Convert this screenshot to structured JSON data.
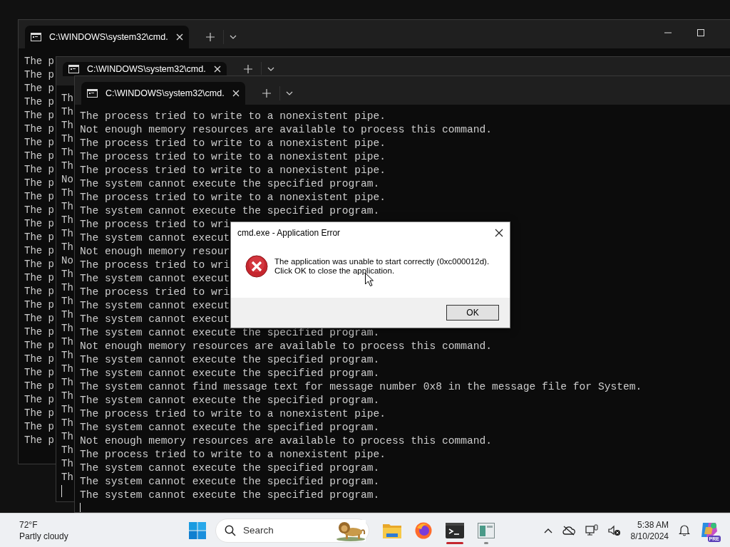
{
  "windows": [
    {
      "tab_title": "C:\\WINDOWS\\system32\\cmd.",
      "lines": [
        "The p",
        "The p",
        "The p",
        "The p",
        "The p",
        "The p",
        "The p",
        "The p",
        "The p",
        "The p",
        "The p",
        "The p",
        "The p",
        "The p",
        "The p",
        "The p",
        "The p",
        "The p",
        "The p",
        "The p",
        "The p",
        "The p",
        "The p",
        "The p",
        "The p",
        "The p",
        "The p",
        "The p",
        "The p"
      ]
    },
    {
      "tab_title": "C:\\WINDOWS\\system32\\cmd.",
      "lines": [
        "Th",
        "Th",
        "Th",
        "Th",
        "Th",
        "Th",
        "No",
        "Th",
        "Th",
        "Th",
        "Th",
        "Th",
        "No",
        "Th",
        "Th",
        "Th",
        "Th",
        "Th",
        "Th",
        "Th",
        "Th",
        "Th",
        "Th",
        "Th",
        "Th",
        "Th",
        "Th",
        "Th",
        "Th"
      ]
    },
    {
      "tab_title": "C:\\WINDOWS\\system32\\cmd.",
      "lines": [
        "The process tried to write to a nonexistent pipe.",
        "Not enough memory resources are available to process this command.",
        "The process tried to write to a nonexistent pipe.",
        "The process tried to write to a nonexistent pipe.",
        "The process tried to write to a nonexistent pipe.",
        "The system cannot execute the specified program.",
        "The process tried to write to a nonexistent pipe.",
        "The system cannot execute the specified program.",
        "The process tried to wri",
        "The system cannot execut",
        "Not enough memory resour",
        "The process tried to wri",
        "The system cannot execut",
        "The process tried to wri",
        "The system cannot execut",
        "The system cannot execut",
        "The system cannot execute the specified program.",
        "Not enough memory resources are available to process this command.",
        "The system cannot execute the specified program.",
        "The system cannot execute the specified program.",
        "The system cannot find message text for message number 0x8 in the message file for System.",
        "The system cannot execute the specified program.",
        "The process tried to write to a nonexistent pipe.",
        "The system cannot execute the specified program.",
        "Not enough memory resources are available to process this command.",
        "The process tried to write to a nonexistent pipe.",
        "The system cannot execute the specified program.",
        "The system cannot execute the specified program.",
        "The system cannot execute the specified program."
      ]
    }
  ],
  "dialog": {
    "title": "cmd.exe - Application Error",
    "message_lines": [
      "The application was unable to start correctly (0xc000012d).",
      "Click OK to close the application."
    ],
    "button": "OK"
  },
  "taskbar": {
    "weather": {
      "temperature": "72°F",
      "condition": "Partly cloudy"
    },
    "search": {
      "placeholder": "Search"
    },
    "apps": [
      {
        "kind": "folder",
        "running": false
      },
      {
        "kind": "browser",
        "running": false
      },
      {
        "kind": "terminal",
        "active": true,
        "running": true
      },
      {
        "kind": "app",
        "active": false,
        "running": true
      }
    ],
    "clock": {
      "time": "5:38 AM",
      "date": "8/10/2024"
    },
    "copilot_badge": "PRE"
  }
}
